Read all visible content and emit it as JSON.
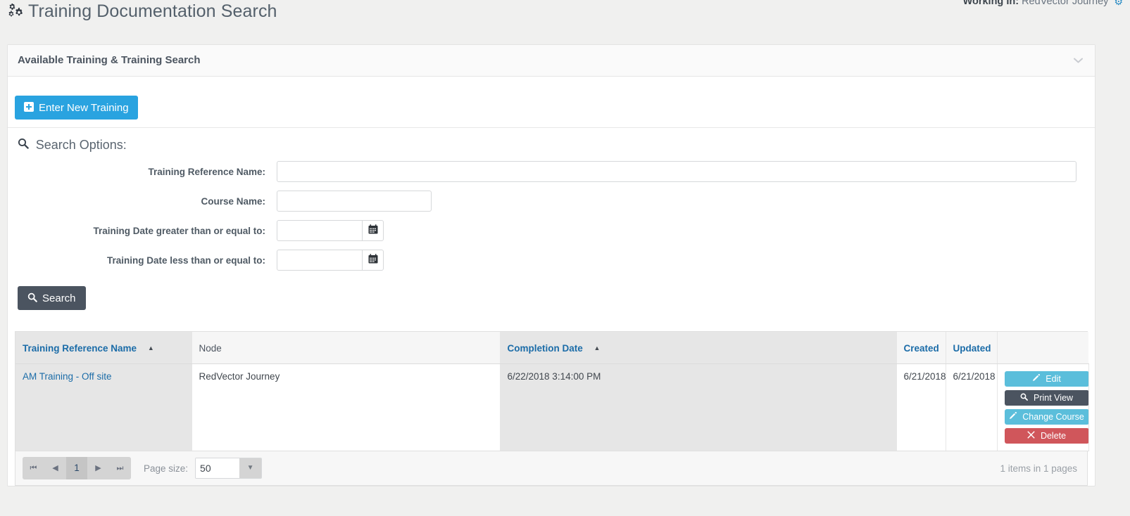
{
  "header": {
    "page_title": "Training Documentation Search",
    "title_icon": "cogs-icon",
    "working_in_label": "Working In:",
    "working_in_value": "RedVector Journey",
    "working_in_icon": "gear-icon"
  },
  "panel": {
    "title": "Available Training & Training Search",
    "collapse_icon": "chevron-down-icon"
  },
  "toolbar": {
    "new_training_label": "Enter New Training",
    "new_training_icon": "plus-square-icon"
  },
  "search": {
    "section_title": "Search Options:",
    "section_icon": "search-icon",
    "fields": [
      {
        "label": "Training Reference Name:",
        "value": "",
        "placeholder": "",
        "type": "text"
      },
      {
        "label": "Course Name:",
        "value": "",
        "placeholder": "",
        "type": "text"
      },
      {
        "label": "Training Date greater than or equal to:",
        "value": "",
        "placeholder": "",
        "type": "date",
        "icon": "calendar-icon"
      },
      {
        "label": "Training Date less than or equal to:",
        "value": "",
        "placeholder": "",
        "type": "date",
        "icon": "calendar-icon"
      }
    ],
    "search_button_label": "Search",
    "search_button_icon": "search-icon"
  },
  "grid": {
    "columns": [
      {
        "label": "Training Reference Name",
        "sorted": "asc"
      },
      {
        "label": "Node",
        "sorted": "none"
      },
      {
        "label": "Completion Date",
        "sorted": "asc"
      },
      {
        "label": "Created",
        "sorted": "none"
      },
      {
        "label": "Updated",
        "sorted": "none"
      },
      {
        "label": "",
        "sorted": "none"
      }
    ],
    "rows": [
      {
        "training_reference_name": "AM Training - Off site",
        "node": "RedVector Journey",
        "completion_date": "6/22/2018 3:14:00 PM",
        "created": "6/21/2018",
        "updated": "6/21/2018",
        "actions": [
          {
            "label": "Edit",
            "icon": "pencil-icon",
            "color": "#5bbedb"
          },
          {
            "label": "Print View",
            "icon": "search-icon",
            "color": "#4b5460"
          },
          {
            "label": "Change Course",
            "icon": "pencil-icon",
            "color": "#5bbedb"
          },
          {
            "label": "Delete",
            "icon": "times-icon",
            "color": "#d0565b"
          }
        ]
      }
    ]
  },
  "pager": {
    "first_icon": "step-backward-icon",
    "prev_icon": "caret-left-icon",
    "current_page": "1",
    "next_icon": "caret-right-icon",
    "last_icon": "step-forward-icon",
    "page_size_label": "Page size:",
    "page_size_value": "50",
    "page_size_arrow_icon": "caret-down-icon",
    "items_count": "1 items in 1 pages"
  },
  "colors": {
    "accent_blue": "#29a3e0",
    "link_blue": "#1b6ca8",
    "dark_slate": "#4b5460",
    "cyan": "#5bbedb",
    "danger_red": "#d0565b"
  }
}
